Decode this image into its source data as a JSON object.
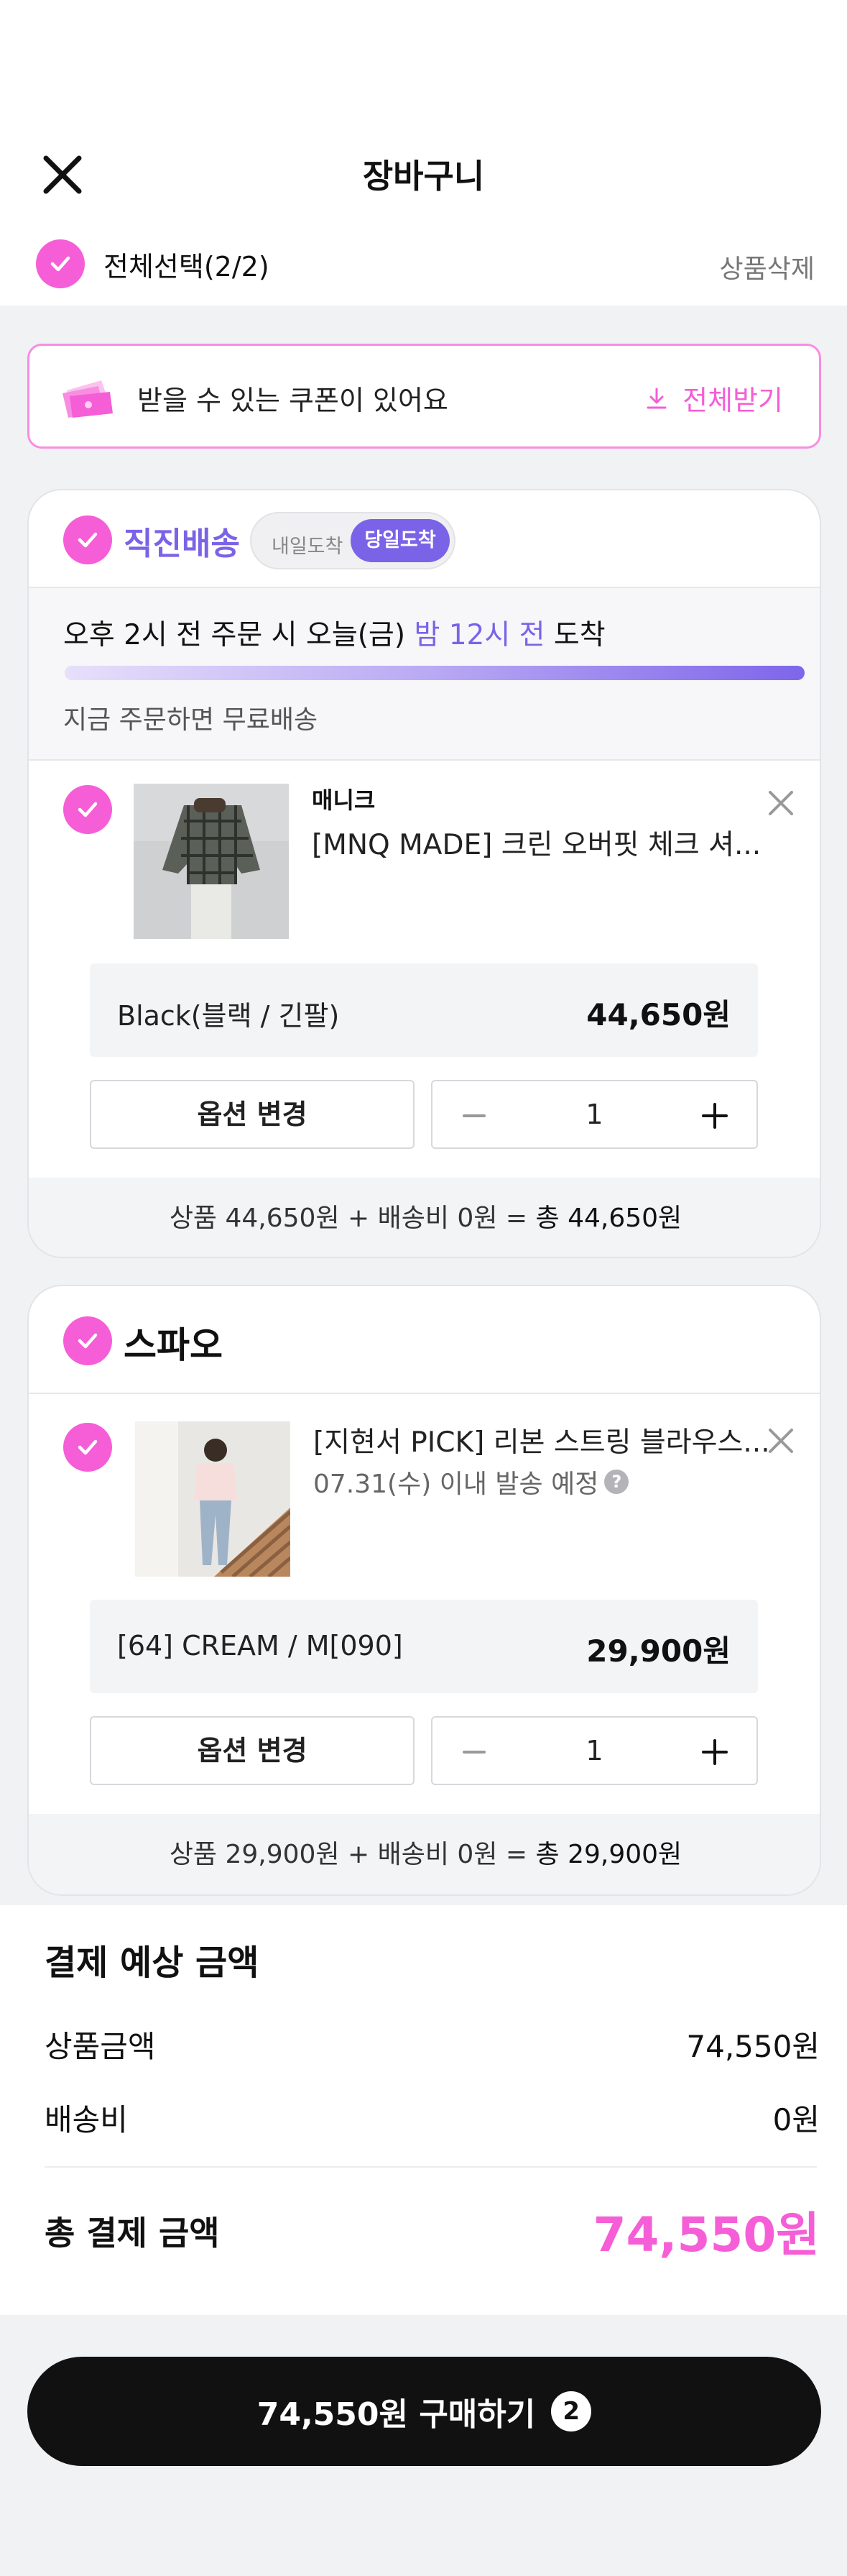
{
  "header": {
    "title": "장바구니",
    "select_all_label": "전체선택(2/2)",
    "delete_label": "상품삭제"
  },
  "coupon": {
    "text": "받을 수 있는 쿠폰이 있어요",
    "download_all_label": "전체받기"
  },
  "stores": [
    {
      "name": "직진배송",
      "toggle": {
        "off_label": "내일도착",
        "on_label": "당일도착"
      },
      "delivery": {
        "prefix": "오후 2시 전 주문 시 오늘(금)",
        "highlight": "밤 12시 전",
        "suffix": "도착",
        "free_shipping_text": "지금 주문하면 무료배송"
      },
      "item": {
        "brand": "매니크",
        "name": "[MNQ MADE] 크린 오버핏 체크 셔...",
        "option": "Black(블랙 / 긴팔)",
        "price": "44,650원",
        "change_option_label": "옵션 변경",
        "quantity": "1"
      },
      "summary": {
        "text": "상품 44,650원 + 배송비 0원 =",
        "total": "총 44,650원"
      }
    },
    {
      "name": "스파오",
      "item": {
        "name": "[지현서 PICK] 리본 스트링 블라우스...",
        "shipping_note": "07.31(수) 이내 발송 예정",
        "help_icon": "?",
        "option": "[64] CREAM / M[090]",
        "price": "29,900원",
        "change_option_label": "옵션 변경",
        "quantity": "1"
      },
      "summary": {
        "text": "상품 29,900원 + 배송비 0원 =",
        "total": "총 29,900원"
      }
    }
  ],
  "payment": {
    "title": "결제 예상 금액",
    "product_label": "상품금액",
    "product_value": "74,550원",
    "shipping_label": "배송비",
    "shipping_value": "0원",
    "total_label": "총 결제 금액",
    "total_value": "74,550원"
  },
  "buy_button": {
    "label": "74,550원 구매하기",
    "count": "2"
  },
  "colors": {
    "accent_pink": "#f55ed6",
    "accent_purple": "#7b63e8",
    "dark": "#111111"
  },
  "icons": [
    "close-icon",
    "check-icon",
    "coupon-icon",
    "download-icon",
    "remove-item-icon",
    "minus-icon",
    "plus-icon",
    "help-icon"
  ]
}
